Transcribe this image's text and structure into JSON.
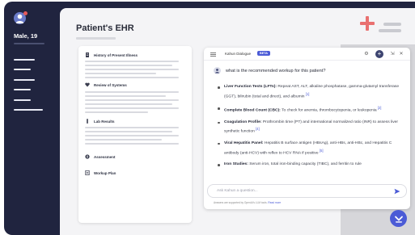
{
  "patient": {
    "label": "Male, 19",
    "avatar_icon": "user-avatar-icon"
  },
  "page": {
    "title": "Patient's EHR"
  },
  "ehr_sections": [
    {
      "label": "History of Present Illness",
      "icon": "document-icon"
    },
    {
      "label": "Review of Systems",
      "icon": "heart-icon"
    },
    {
      "label": "Lab Results",
      "icon": "test-tube-icon"
    },
    {
      "label": "Assessment",
      "icon": "clipboard-icon"
    },
    {
      "label": "Workup Plan",
      "icon": "list-icon"
    }
  ],
  "chat": {
    "title": "Kahun Dialogue",
    "badge": "BETA",
    "question": "what is the recommended workup for this patient?",
    "answers": [
      {
        "term": "Liver Function Tests (LFTs):",
        "text": " Repeat AST, ALT, alkaline phosphatase, gamma-glutamyl transferase (GGT), bilirubin (total and direct), and albumin",
        "ref": "[1]"
      },
      {
        "term": "Complete Blood Count (CBC):",
        "text": " To check for anemia, thrombocytopenia, or leukopenia",
        "ref": "[2]"
      },
      {
        "term": "Coagulation Profile:",
        "text": " Prothrombin time (PT) and international normalized ratio (INR) to assess liver synthetic function",
        "ref": "[4]"
      },
      {
        "term": "Viral Hepatitis Panel:",
        "text": " Hepatitis B surface antigen (HBsAg), anti-HBs, anti-HBc, and Hepatitis C antibody (anti-HCV) with reflex to HCV RNA if positive",
        "ref": "[5]"
      },
      {
        "term": "Iron Studies:",
        "text": " Serum iron, total iron-binding capacity (TIBC), and ferritin to rule",
        "ref": ""
      }
    ],
    "input_placeholder": "Ask Kahun a question...",
    "disclaimer": "Answers are supported by OpenAI's LLM tools.",
    "disclaimer_link": "Read more"
  },
  "colors": {
    "sidebar": "#20243f",
    "accent": "#4b5bd6",
    "plus": "#e97070"
  }
}
